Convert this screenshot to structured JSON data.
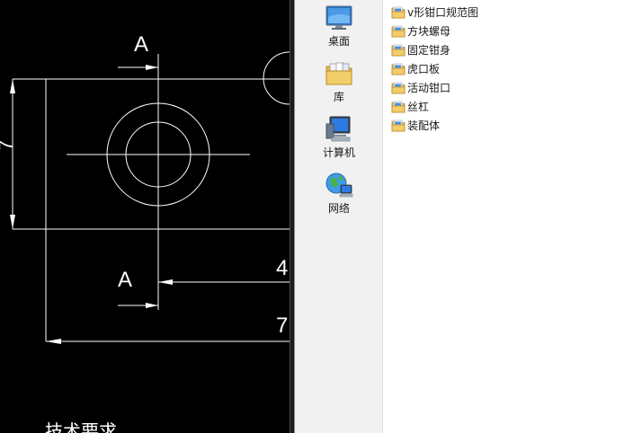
{
  "cad": {
    "section_label_top": "A",
    "section_label_bottom": "A",
    "dim_partial_left": "7",
    "dim_partial_4": "4",
    "dim_partial_7": "7",
    "tech_req_partial": "技术要求"
  },
  "nav": {
    "items": [
      {
        "label": "桌面",
        "icon": "desktop-icon"
      },
      {
        "label": "库",
        "icon": "library-icon"
      },
      {
        "label": "计算机",
        "icon": "computer-icon"
      },
      {
        "label": "网络",
        "icon": "network-icon"
      }
    ]
  },
  "files": {
    "items": [
      {
        "label": "v形钳口规范图",
        "icon": "folder-icon"
      },
      {
        "label": "方块螺母",
        "icon": "folder-icon"
      },
      {
        "label": "固定钳身",
        "icon": "folder-icon"
      },
      {
        "label": "虎口板",
        "icon": "folder-icon"
      },
      {
        "label": "活动钳口",
        "icon": "folder-icon"
      },
      {
        "label": "丝杠",
        "icon": "folder-icon"
      },
      {
        "label": "装配体",
        "icon": "folder-icon"
      }
    ]
  },
  "colors": {
    "cad_background": "#000000",
    "cad_lines": "#ffffff",
    "nav_background": "#f1f1f1",
    "list_background": "#ffffff",
    "folder_yellow": "#f2c94c"
  }
}
